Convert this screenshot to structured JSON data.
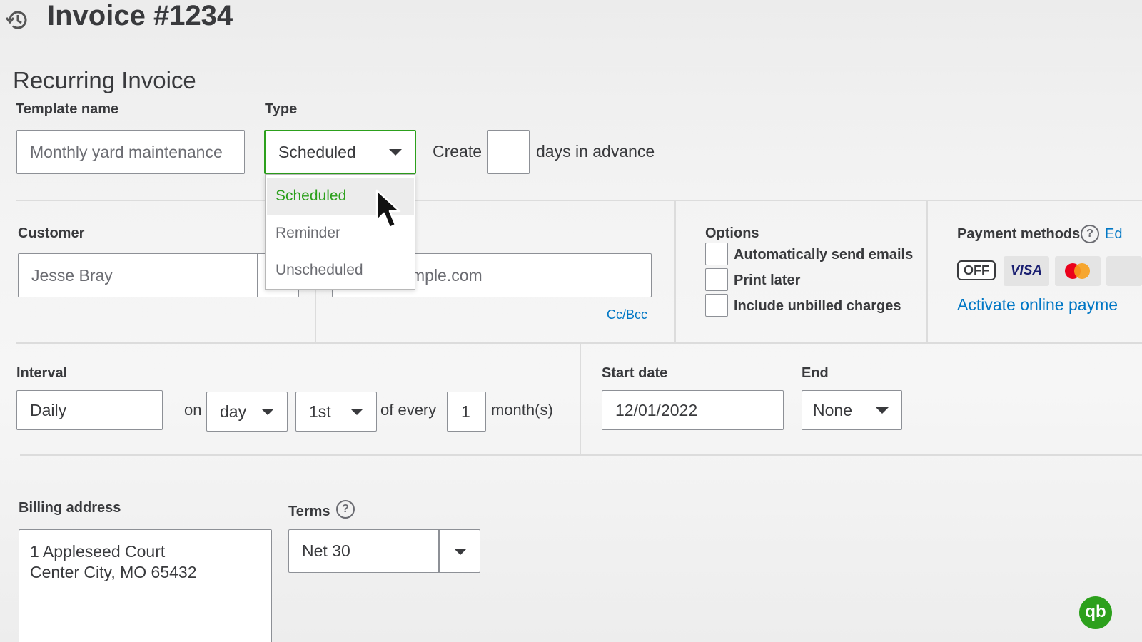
{
  "header": {
    "history_icon": "history-icon",
    "title": "Invoice #1234"
  },
  "form": {
    "heading": "Recurring Invoice",
    "template_name": {
      "label": "Template name",
      "value": "Monthly yard maintenance"
    },
    "type": {
      "label": "Type",
      "selected": "Scheduled",
      "options": [
        "Scheduled",
        "Reminder",
        "Unscheduled"
      ],
      "accent_color": "#2ca01c"
    },
    "create": {
      "prefix": "Create",
      "value": "",
      "suffix": "days in advance"
    },
    "customer": {
      "label": "Customer",
      "value": "Jesse Bray"
    },
    "email": {
      "value_visible": "mple.com",
      "ccbcc": "Cc/Bcc"
    },
    "options": {
      "label": "Options",
      "items": [
        "Automatically send emails",
        "Print later",
        "Include unbilled charges"
      ]
    },
    "payment": {
      "label": "Payment methods",
      "edit_link": "Ed",
      "toggle": "OFF",
      "visa": "VISA",
      "activate_link": "Activate online payme"
    },
    "interval": {
      "label": "Interval",
      "frequency": "Daily",
      "on_label": "on",
      "day_select": "day",
      "ordinal_select": "1st",
      "of_every_label": "of every",
      "every_value": "1",
      "months_label": "month(s)"
    },
    "start_date": {
      "label": "Start date",
      "value": "12/01/2022"
    },
    "end": {
      "label": "End",
      "value": "None"
    },
    "billing_address": {
      "label": "Billing address",
      "line1": "1 Appleseed Court",
      "line2": "Center City, MO 65432"
    },
    "terms": {
      "label": "Terms",
      "value": "Net 30"
    }
  },
  "brand": {
    "logo_text": "qb",
    "logo_color": "#2ca01c"
  }
}
